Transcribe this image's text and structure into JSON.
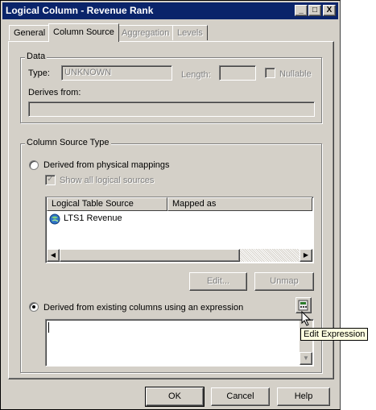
{
  "window": {
    "title": "Logical Column - Revenue Rank",
    "controls": {
      "minimize": "_",
      "maximize": "□",
      "close": "X"
    }
  },
  "tabs": [
    {
      "label": "General",
      "state": "normal"
    },
    {
      "label": "Column Source",
      "state": "active"
    },
    {
      "label": "Aggregation",
      "state": "disabled"
    },
    {
      "label": "Levels",
      "state": "disabled"
    }
  ],
  "data_group": {
    "title": "Data",
    "type_label": "Type:",
    "type_value": "UNKNOWN",
    "length_label": "Length:",
    "length_value": "",
    "nullable_label": "Nullable",
    "derives_label": "Derives from:",
    "derives_value": ""
  },
  "source_group": {
    "title": "Column Source Type",
    "physical_label": "Derived from physical mappings",
    "physical_selected": false,
    "show_all_label": "Show all logical sources",
    "show_all_checked": true,
    "table": {
      "columns": [
        "Logical Table Source",
        "Mapped as"
      ],
      "rows": [
        {
          "source": "LTS1 Revenue",
          "mapped_as": ""
        }
      ]
    },
    "edit_button": "Edit...",
    "unmap_button": "Unmap",
    "expression_label": "Derived from existing columns using an expression",
    "expression_selected": true,
    "expression_value": ""
  },
  "tooltip": "Edit Expression",
  "footer": {
    "ok": "OK",
    "cancel": "Cancel",
    "help": "Help"
  },
  "colors": {
    "face": "#d4d0c8",
    "titlebar": "#0a246a",
    "tooltip": "#ffffe1"
  }
}
